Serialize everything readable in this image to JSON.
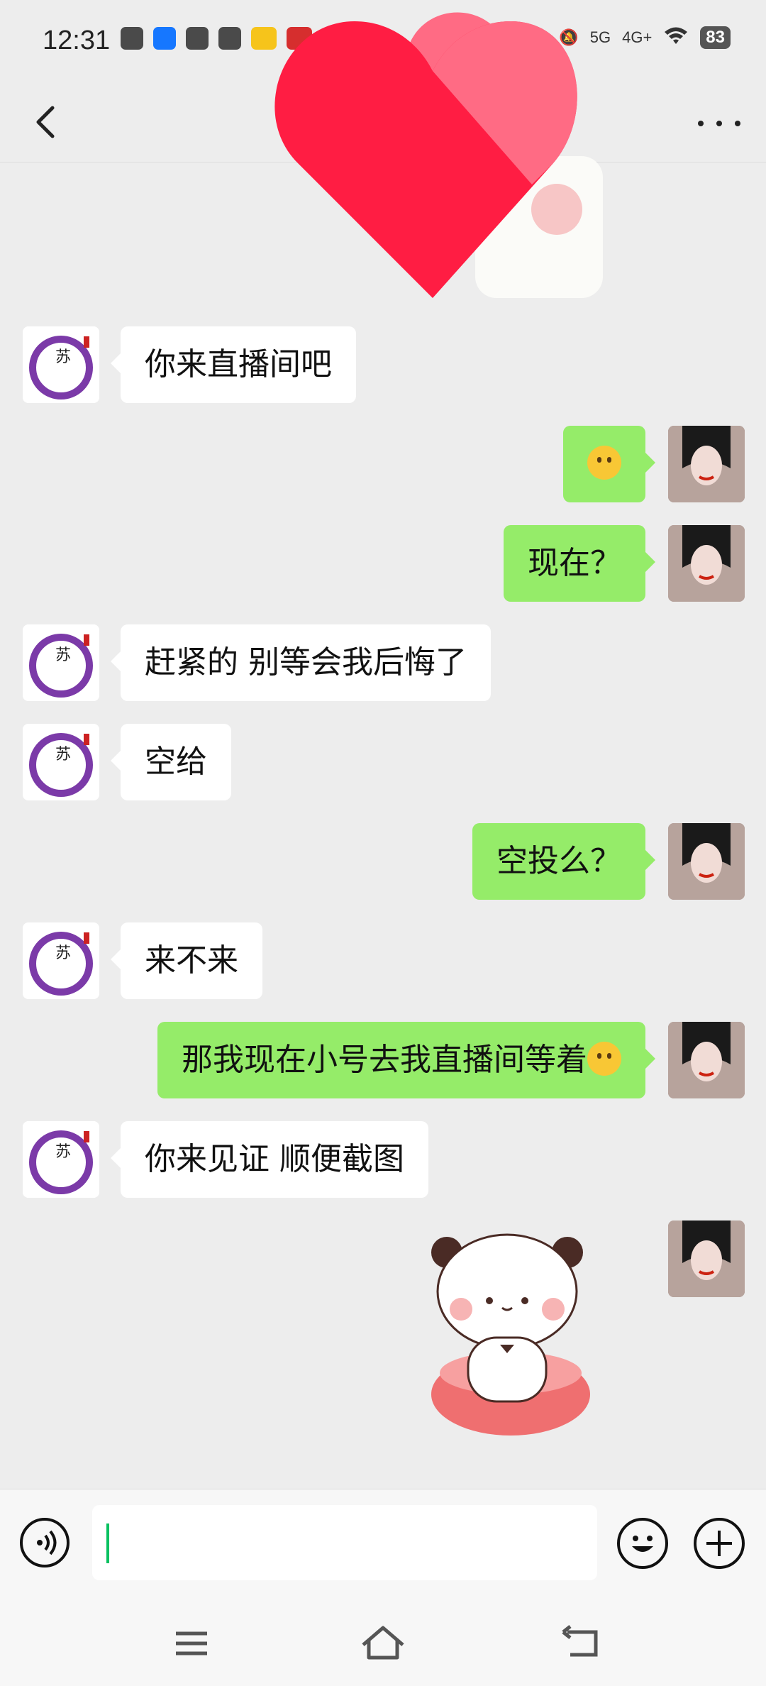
{
  "status_bar": {
    "time": "12:31",
    "network": "5G",
    "network2": "4G+",
    "battery": "83"
  },
  "header": {
    "back_icon": "chevron-left-icon",
    "more_icon": "more-dots-icon"
  },
  "messages": [
    {
      "side": "in",
      "text": "你来直播间吧"
    },
    {
      "side": "out",
      "text": "",
      "emoji": "surprised-face"
    },
    {
      "side": "out",
      "text": "现在？"
    },
    {
      "side": "in",
      "text": "赶紧的 别等会我后悔了"
    },
    {
      "side": "in",
      "text": "空给"
    },
    {
      "side": "out",
      "text": "空投么？"
    },
    {
      "side": "in",
      "text": "来不来"
    },
    {
      "side": "out",
      "text": "那我现在小号去我直播间等着",
      "emoji": "thinking-face"
    },
    {
      "side": "in",
      "text": "你来见证 顺便截图"
    }
  ],
  "colors": {
    "outgoing_bubble": "#95ec69",
    "incoming_bubble": "#ffffff",
    "background": "#ededed"
  }
}
